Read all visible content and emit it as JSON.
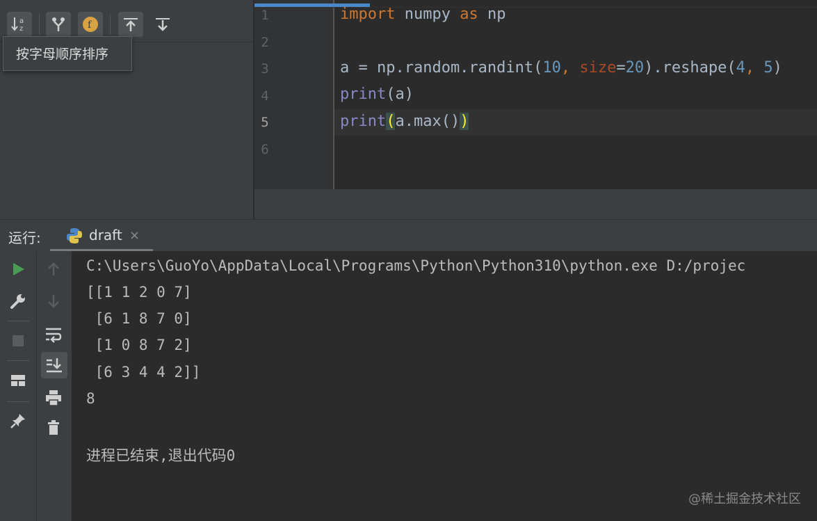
{
  "structure_toolbar": {
    "buttons": [
      {
        "name": "sort-alpha",
        "icon": "sort-alphabetically-icon"
      },
      {
        "name": "show-inherited",
        "icon": "merge-icon"
      },
      {
        "name": "show-fields",
        "icon": "field-f-icon"
      },
      {
        "name": "expand-all",
        "icon": "expand-up-icon"
      },
      {
        "name": "collapse-all",
        "icon": "collapse-down-icon"
      }
    ],
    "tooltip": "按字母顺序排序"
  },
  "editor": {
    "line_numbers": [
      "1",
      "2",
      "3",
      "4",
      "5",
      "6"
    ],
    "lines": {
      "l1_kw1": "import",
      "l1_mid": " numpy ",
      "l1_kw2": "as",
      "l1_end": " np",
      "l3_a": "a = np.random.randint(",
      "l3_n1": "10",
      "l3_comma": ", ",
      "l3_param": "size",
      "l3_eq": "=",
      "l3_n2": "20",
      "l3_mid": ").reshape(",
      "l3_n3": "4",
      "l3_comma2": ", ",
      "l3_n4": "5",
      "l3_end": ")",
      "l4_fn": "print",
      "l4_rest": "(a)",
      "l5_fn": "print",
      "l5_open": "(",
      "l5_mid": "a.max()",
      "l5_close": ")"
    }
  },
  "run_window": {
    "label": "运行:",
    "tab_name": "draft",
    "tab_close": "×",
    "output": [
      "C:\\Users\\GuoYo\\AppData\\Local\\Programs\\Python\\Python310\\python.exe D:/projec",
      "[[1 1 2 0 7]",
      " [6 1 8 7 0]",
      " [1 0 8 7 2]",
      " [6 3 4 4 2]]",
      "8",
      "",
      "进程已结束,退出代码0"
    ]
  },
  "watermark": "@稀土掘金技术社区",
  "colors": {
    "accent": "#4a88c7",
    "run_green": "#499c54",
    "keyword": "#cc7832",
    "builtin": "#8888c6",
    "number": "#6897bb"
  }
}
